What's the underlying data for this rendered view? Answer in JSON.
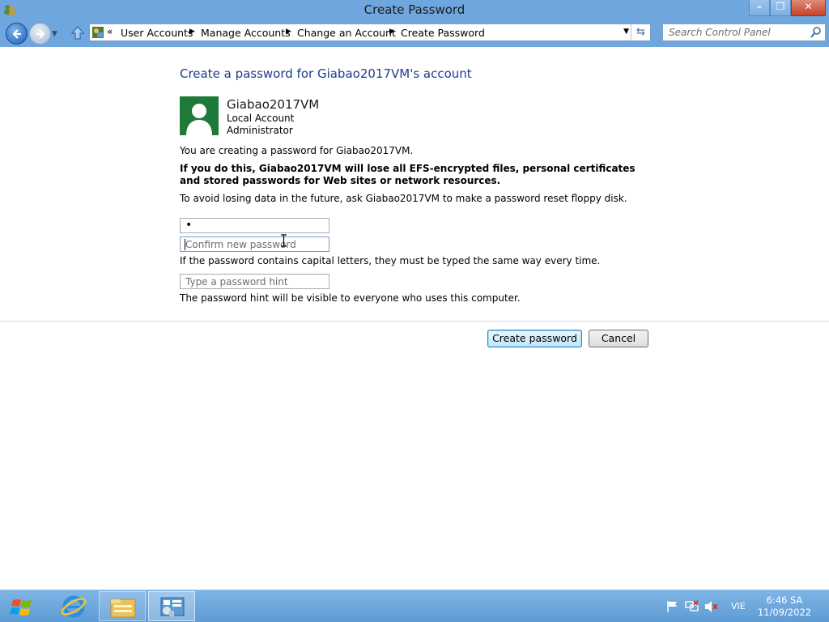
{
  "window": {
    "title": "Create Password",
    "minimize_label": "–",
    "maximize_label": "❐",
    "close_label": "✕"
  },
  "addressbar": {
    "overflow": "«",
    "breadcrumbs": [
      "User Accounts",
      "Manage Accounts",
      "Change an Account",
      "Create Password"
    ],
    "search_placeholder": "Search Control Panel"
  },
  "main": {
    "heading": "Create a password for Giabao2017VM's account",
    "user": {
      "name": "Giabao2017VM",
      "account_type": "Local Account",
      "role": "Administrator"
    },
    "intro": "You are creating a password for Giabao2017VM.",
    "warning": "If you do this, Giabao2017VM will lose all EFS-encrypted files, personal certificates and stored passwords for Web sites or network resources.",
    "advice": "To avoid losing data in the future, ask Giabao2017VM to make a password reset floppy disk.",
    "new_password_value": "•",
    "confirm_placeholder": "Confirm new password",
    "caps_note": "If the password contains capital letters, they must be typed the same way every time.",
    "hint_placeholder": "Type a password hint",
    "hint_note": "The password hint will be visible to everyone who uses this computer.",
    "create_button": "Create password",
    "cancel_button": "Cancel"
  },
  "taskbar": {
    "language": "VIE",
    "time": "6:46 SA",
    "date": "11/09/2022"
  }
}
